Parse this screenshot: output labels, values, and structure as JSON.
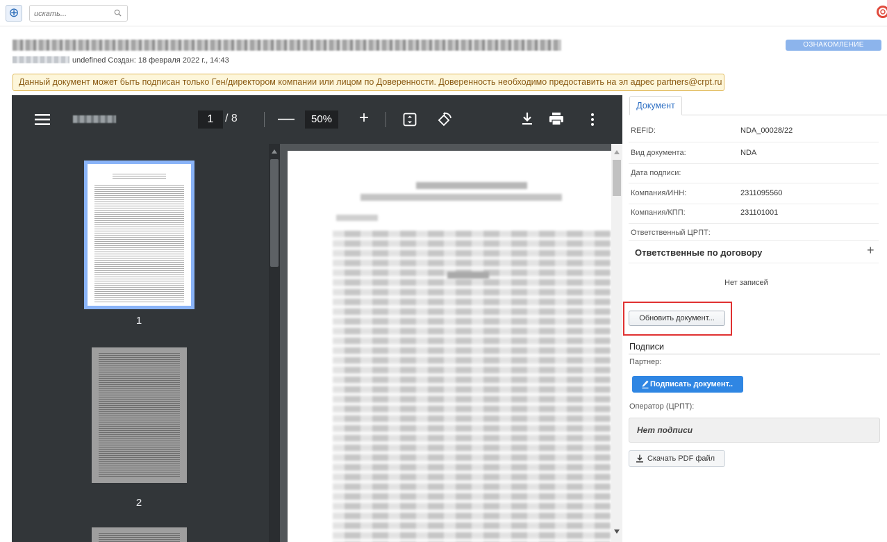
{
  "topbar": {
    "add_icon_label": "⊕",
    "search_placeholder": "искать..."
  },
  "header": {
    "created_text": "undefined Создан: 18 февраля 2022 г., 14:43",
    "status_badge": "ОЗНАКОМЛЕНИЕ",
    "warning": "Данный документ может быть подписан только Ген/директором компании или лицом по Доверенности. Доверенность необходимо предоставить на эл адрес partners@crpt.ru"
  },
  "viewer": {
    "page_current": "1",
    "page_total": "/ 8",
    "zoom": "50%",
    "zoom_out": "—",
    "zoom_in": "+",
    "thumbnails": [
      {
        "number": "1"
      },
      {
        "number": "2"
      }
    ]
  },
  "panel": {
    "tab_label": "Документ",
    "properties": [
      {
        "label": "REFID:",
        "value": "NDA_00028/22"
      },
      {
        "label": "Вид документа:",
        "value": "NDA"
      },
      {
        "label": "Дата подписи:",
        "value": ""
      },
      {
        "label": "Компания/ИНН:",
        "value": "2311095560"
      },
      {
        "label": "Компания/КПП:",
        "value": "231101001"
      },
      {
        "label": "Ответственный ЦРПТ:",
        "value": ""
      }
    ],
    "responsible_title": "Ответственные по договору",
    "plus_label": "+",
    "no_records": "Нет записей",
    "update_button": "Обновить документ...",
    "signatures_title": "Подписи",
    "partner_label": "Партнер:",
    "sign_button": "Подписать документ..",
    "operator_label": "Оператор (ЦРПТ):",
    "no_signature": "Нет подписи",
    "download_button": "Скачать PDF файл"
  },
  "colors": {
    "accent": "#2f86e3",
    "status_badge": "#8cb4ec",
    "warning_bg": "#fdf6da",
    "highlight": "#e03131",
    "viewer_toolbar": "#323639"
  },
  "icons": [
    "add-icon",
    "search-icon",
    "help-lifebuoy-icon",
    "menu-icon",
    "fit-page-icon",
    "rotate-icon",
    "download-icon",
    "print-icon",
    "more-vert-icon",
    "plus-icon",
    "pen-icon",
    "download-pdf-icon"
  ]
}
